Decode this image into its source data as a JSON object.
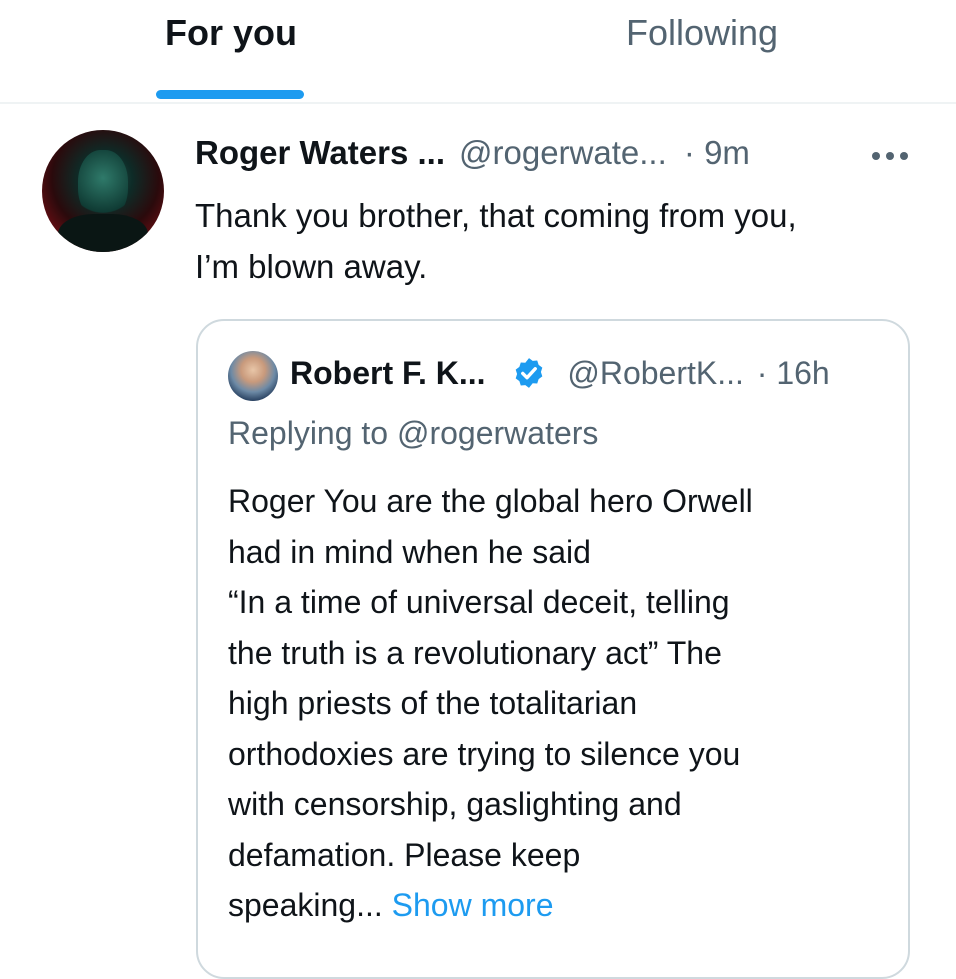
{
  "tabs": {
    "for_you": "For you",
    "following": "Following",
    "active": "For you"
  },
  "tweet": {
    "author_name": "Roger Waters ...",
    "author_handle": "@rogerwate...",
    "time": "· 9m",
    "text": "Thank you brother, that coming from you,\nI’m blown away."
  },
  "quote": {
    "author_name": "Robert F. K...",
    "author_handle": "@RobertK...",
    "time": "· 16h",
    "replying_to": "Replying to @rogerwaters",
    "text": "Roger   You are the global hero Orwell\nhad in mind when he said\n“In a time of universal deceit, telling\nthe truth is a revolutionary act” The\nhigh priests of the totalitarian\northodoxies are trying to silence you\nwith censorship, gaslighting and\ndefamation. Please keep\nspeaking... ",
    "show_more": "Show more"
  },
  "icons": {
    "more": "more-horizontal-icon",
    "verified": "verified-badge-icon"
  },
  "colors": {
    "accent": "#1d9bf0",
    "text": "#0f1419",
    "muted": "#536471",
    "border": "#cfd9de"
  }
}
